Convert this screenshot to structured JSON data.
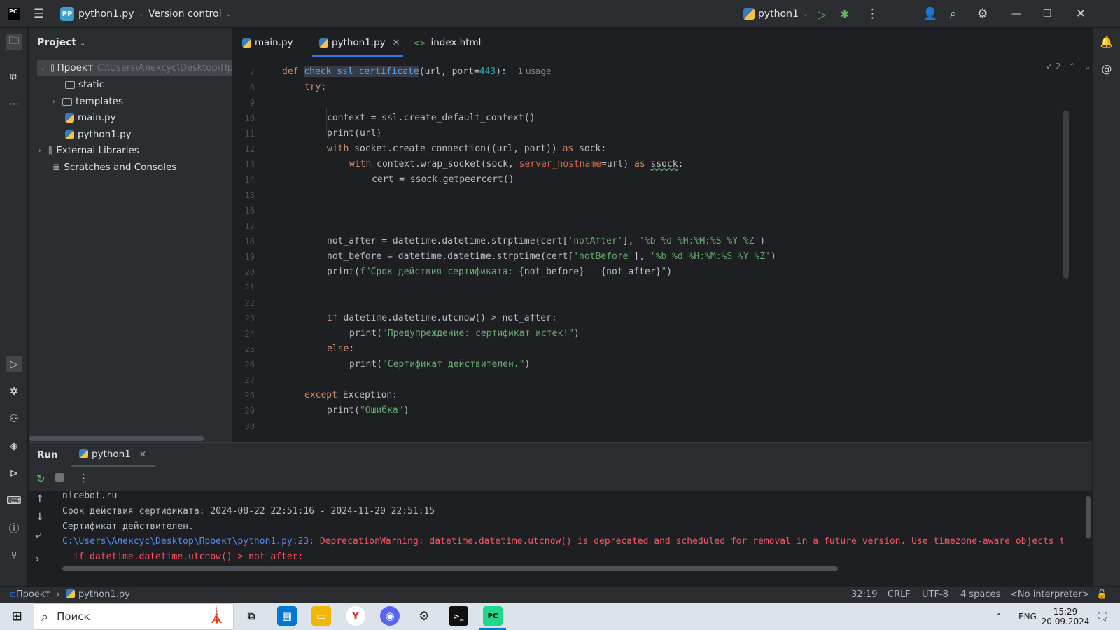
{
  "titlebar": {
    "project_badge": "PP",
    "project_name": "python1.py",
    "vcs_label": "Version control",
    "run_config": "python1"
  },
  "project_panel": {
    "title": "Project",
    "root_name": "Проект",
    "root_path": "C:\\Users\\Алексус\\Desktop\\Пр",
    "items": [
      {
        "label": "static"
      },
      {
        "label": "templates"
      },
      {
        "label": "main.py"
      },
      {
        "label": "python1.py"
      },
      {
        "label": "External Libraries"
      },
      {
        "label": "Scratches and Consoles"
      }
    ]
  },
  "tabs": [
    {
      "label": "main.py"
    },
    {
      "label": "python1.py"
    },
    {
      "label": "index.html"
    }
  ],
  "editor": {
    "inspection_count": "2",
    "usage_hint": "1 usage",
    "lines": [
      {
        "n": "7"
      },
      {
        "n": "8"
      },
      {
        "n": "9"
      },
      {
        "n": "10"
      },
      {
        "n": "11"
      },
      {
        "n": "12"
      },
      {
        "n": "13"
      },
      {
        "n": "14"
      },
      {
        "n": "15"
      },
      {
        "n": "16"
      },
      {
        "n": "17"
      },
      {
        "n": "18"
      },
      {
        "n": "19"
      },
      {
        "n": "20"
      },
      {
        "n": "21"
      },
      {
        "n": "22"
      },
      {
        "n": "23"
      },
      {
        "n": "24"
      },
      {
        "n": "25"
      },
      {
        "n": "26"
      },
      {
        "n": "27"
      },
      {
        "n": "28"
      },
      {
        "n": "29"
      },
      {
        "n": "30"
      }
    ],
    "code": {
      "l7_def": "def ",
      "l7_fn": "check_ssl_certificate",
      "l7_a": "(url, port=",
      "l7_num": "443",
      "l7_b": "):",
      "l8": "try:",
      "l10": "context = ssl.create_default_context()",
      "l11": "print(url)",
      "l12_kw": "with",
      "l12_a": " socket.create_connection((url, port)) ",
      "l12_kw2": "as",
      "l12_b": " sock:",
      "l13_kw": "with",
      "l13_a": " context.wrap_socket(sock, ",
      "l13_param": "server_hostname",
      "l13_b": "=url) ",
      "l13_kw2": "as",
      "l13_c": " ",
      "l13_var": "ssock",
      "l13_d": ":",
      "l14": "cert = ssock.getpeercert()",
      "l18_a": "not_after = datetime.datetime.strptime(cert[",
      "l18_s1": "'notAfter'",
      "l18_b": "], ",
      "l18_s2": "'%b %d %H:%M:%S %Y %Z'",
      "l18_c": ")",
      "l19_a": "not_before = datetime.datetime.strptime(cert[",
      "l19_s1": "'notBefore'",
      "l19_b": "], ",
      "l19_s2": "'%b %d %H:%M:%S %Y %Z'",
      "l19_c": ")",
      "l20_a": "print(",
      "l20_s1": "f\"Срок действия сертификата: ",
      "l20_v1": "{not_before}",
      "l20_s2": " - ",
      "l20_v2": "{not_after}",
      "l20_s3": "\"",
      "l20_b": ")",
      "l23_kw": "if",
      "l23_a": " datetime.datetime.utcnow() > not_after:",
      "l24_a": "print(",
      "l24_s": "\"Предупреждение: сертификат истек!\"",
      "l24_b": ")",
      "l25_kw": "else",
      "l25_a": ":",
      "l26_a": "print(",
      "l26_s": "\"Сертификат действителен.\"",
      "l26_b": ")",
      "l28_kw": "except",
      "l28_a": " Exception:",
      "l29_a": "print(",
      "l29_s": "\"Ошибка\"",
      "l29_b": ")"
    }
  },
  "run_panel": {
    "title": "Run",
    "tab_label": "python1",
    "output": {
      "line1": "nicebot.ru",
      "line2": "Срок действия сертификата: 2024-08-22 22:51:16 - 2024-11-20 22:51:15",
      "line3": "Сертификат действителен.",
      "link": "C:\\Users\\Алексус\\Desktop\\Проект\\python1.py:23",
      "warning": ": DeprecationWarning: datetime.datetime.utcnow() is deprecated and scheduled for removal in a future version. Use timezone-aware objects to",
      "line5": "  if datetime.datetime.utcnow() > not_after:"
    }
  },
  "statusbar": {
    "crumb_root": "Проект",
    "crumb_file": "python1.py",
    "position": "32:19",
    "line_sep": "CRLF",
    "encoding": "UTF-8",
    "indent": "4 spaces",
    "interpreter": "<No interpreter>"
  },
  "taskbar": {
    "search_label": "Поиск",
    "lang": "ENG",
    "time": "15:29",
    "date": "20.09.2024"
  }
}
